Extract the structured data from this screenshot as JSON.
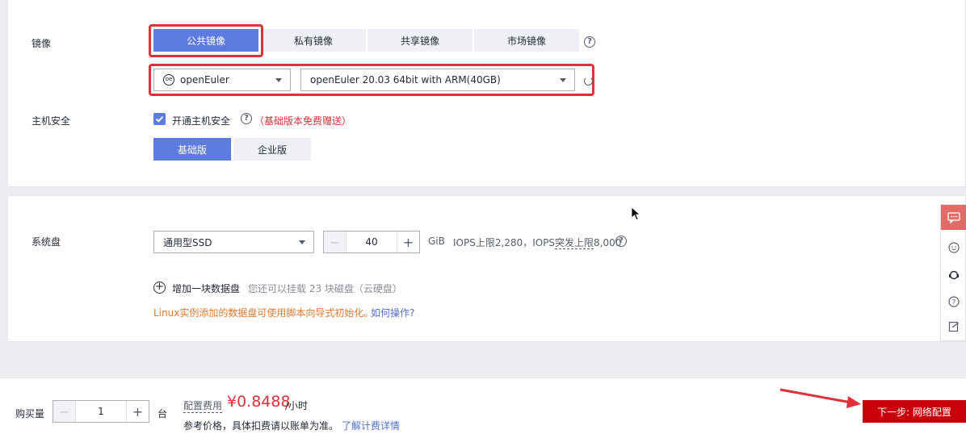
{
  "image": {
    "label": "镜像",
    "tabs": [
      "公共镜像",
      "私有镜像",
      "共享镜像",
      "市场镜像"
    ],
    "os_select": "openEuler",
    "version_select": "openEuler 20.03 64bit with ARM(40GB)"
  },
  "host_security": {
    "label": "主机安全",
    "checkbox_label": "开通主机安全",
    "note": "（基础版本免费赠送）",
    "editions": [
      "基础版",
      "企业版"
    ]
  },
  "system_disk": {
    "label": "系统盘",
    "type": "通用型SSD",
    "size": "40",
    "unit": "GiB",
    "iops_text_a": "IOPS上限2,280，IOPS",
    "iops_text_b": "突发上限",
    "iops_text_c": "8,000",
    "add_disk_label": "增加一块数据盘",
    "add_disk_hint": "您还可以挂载 23 块磁盘（云硬盘）",
    "linux_note": "Linux实例添加的数据盘可使用脚本向导式初始化。",
    "linux_link": "如何操作?"
  },
  "footer": {
    "quantity_label": "购买量",
    "quantity": "1",
    "quantity_unit": "台",
    "fee_label": "配置费用",
    "price": "¥0.8488",
    "price_unit": "/小时",
    "reference_note": "参考价格，具体扣费请以账单为准。",
    "billing_link": "了解计费详情",
    "next_button": "下一步: 网络配置"
  },
  "colors": {
    "primary": "#5e7ce0",
    "highlight": "#e0303a",
    "price": "#e0303a",
    "next_button": "#c7000b"
  }
}
